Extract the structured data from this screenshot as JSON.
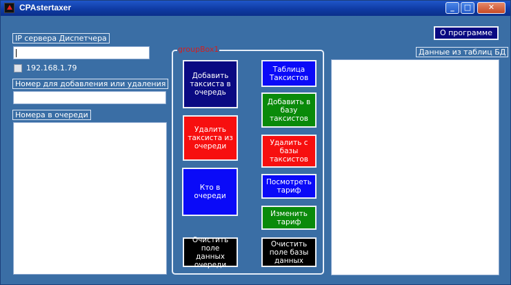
{
  "window": {
    "title": "CPAstertaxer",
    "minimize_glyph": "_",
    "maximize_glyph": "□",
    "close_glyph": "✕"
  },
  "left": {
    "ip_label": "IP сервера Диспетчера",
    "ip_value": "",
    "checkbox_label": "192.168.1.79",
    "checkbox_checked": false,
    "number_label": "Номер для добавления или удаления",
    "number_value": "",
    "queue_label": "Номера в очереди"
  },
  "groupbox": {
    "title": "groupBox1",
    "buttons": {
      "add_to_queue": "Добавить таксиста в очередь",
      "remove_from_queue": "Удалить таксиста из очереди",
      "who_in_queue": "Кто в очереди",
      "clear_queue_field": "Очистить поле данных очереди",
      "taxi_table": "Таблица Таксистов",
      "add_to_db": "Добавить в базу таксистов",
      "remove_from_db": "Удалить с базы таксистов",
      "view_tariff": "Посмотреть тариф",
      "change_tariff": "Изменить тариф",
      "clear_db_field": "Очистить поле базы данных"
    }
  },
  "right": {
    "about_button": "О программе",
    "db_label": "Данные из таблиц БД"
  },
  "colors": {
    "form_bg": "#3a6ea5",
    "navy": "#0a0a82",
    "red": "#f70f0f",
    "blue": "#0a0af8",
    "green": "#0a8a0a",
    "black": "#000000"
  }
}
